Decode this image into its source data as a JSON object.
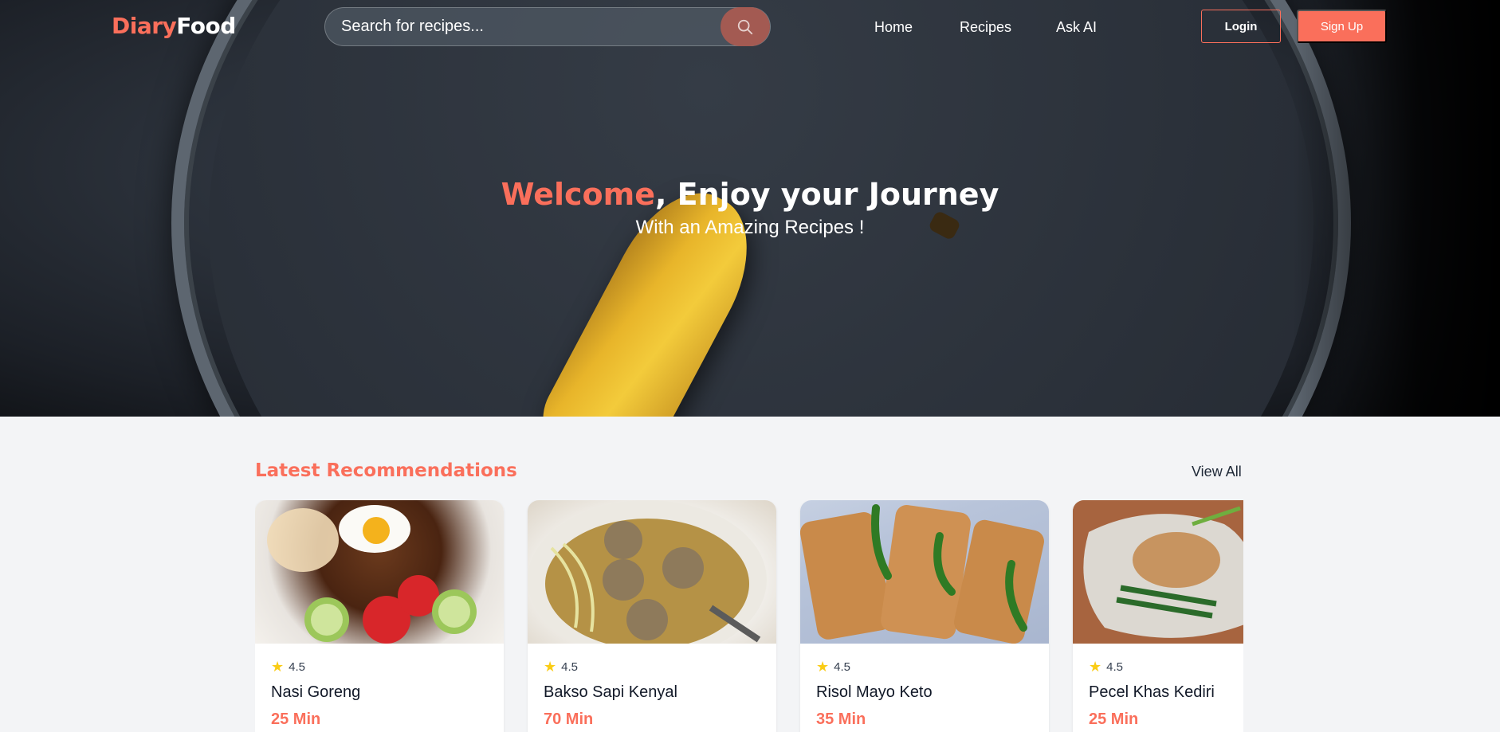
{
  "navbar": {
    "brand_part1": "Diary",
    "brand_part2": "Food",
    "search_placeholder": "Search for recipes...",
    "links": [
      "Home",
      "Recipes",
      "Ask AI"
    ],
    "login_label": "Login",
    "signup_label": "Sign Up"
  },
  "hero": {
    "title_accent": "Welcome",
    "title_rest": ", Enjoy your Journey",
    "subtitle": "With an Amazing Recipes !"
  },
  "recommendations": {
    "title": "Latest Recommendations",
    "view_all_label": "View All",
    "cards": [
      {
        "name": "Nasi Goreng",
        "rating": "4.5",
        "time": "25 Min",
        "image_icon": "nasi-goreng-image"
      },
      {
        "name": "Bakso Sapi Kenyal",
        "rating": "4.5",
        "time": "70 Min",
        "image_icon": "bakso-image"
      },
      {
        "name": "Risol Mayo Keto",
        "rating": "4.5",
        "time": "35 Min",
        "image_icon": "risol-image"
      },
      {
        "name": "Pecel Khas Kediri",
        "rating": "4.5",
        "time": "25 Min",
        "image_icon": "pecel-image"
      }
    ]
  },
  "colors": {
    "accent": "#fa6f5b",
    "page_bg": "#f3f4f6",
    "star": "#facc15"
  }
}
